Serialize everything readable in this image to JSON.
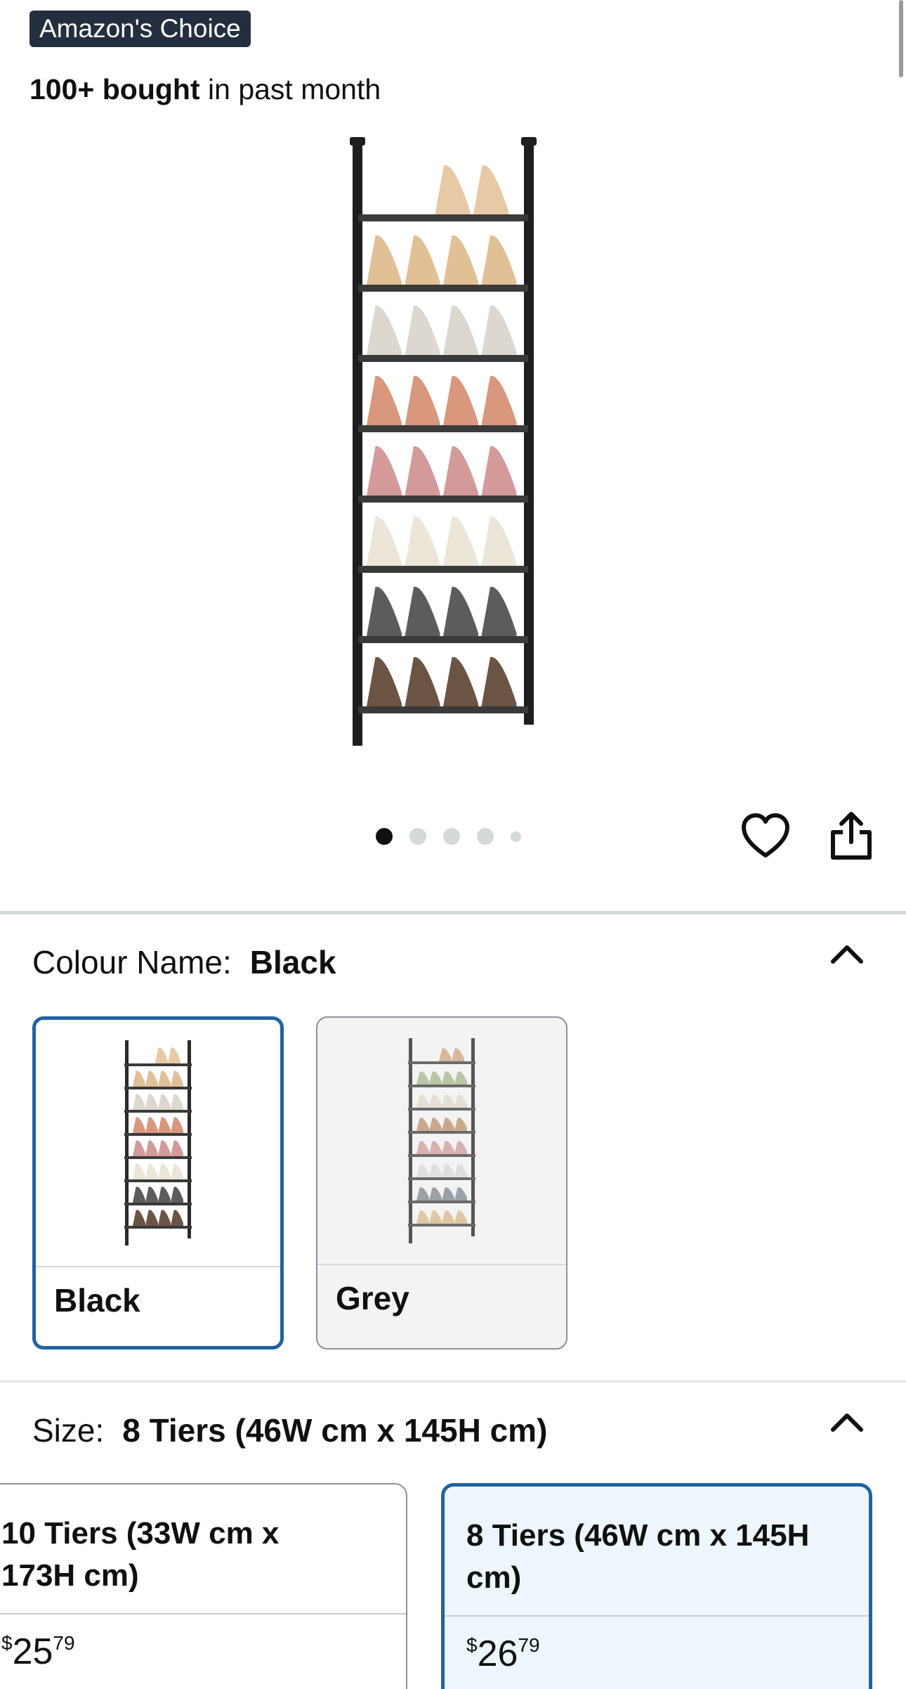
{
  "badge": {
    "label": "Amazon's Choice"
  },
  "social_proof": {
    "bold": "100+ bought",
    "rest": " in past month"
  },
  "gallery": {
    "image_count": 5,
    "active_index": 0
  },
  "actions": {
    "wishlist_icon": "heart-icon",
    "share_icon": "share-icon"
  },
  "colour": {
    "label": "Colour Name:",
    "selected": "Black",
    "options": [
      {
        "label": "Black",
        "selected": true
      },
      {
        "label": "Grey",
        "selected": false
      }
    ]
  },
  "size": {
    "label": "Size:",
    "selected": "8 Tiers (46W cm x 145H cm)",
    "options": [
      {
        "line1": "10 Tiers (33W cm x",
        "line2": "173H cm)",
        "currency": "$",
        "whole": "25",
        "fraction": "79",
        "selected": false
      },
      {
        "line1": "8 Tiers (46W cm x 145H",
        "line2": "cm)",
        "currency": "$",
        "whole": "26",
        "fraction": "79",
        "selected": true
      }
    ]
  },
  "colors": {
    "accent": "#2162a1",
    "badge_bg": "#232f3e",
    "selected_bg": "#edf6fd"
  }
}
